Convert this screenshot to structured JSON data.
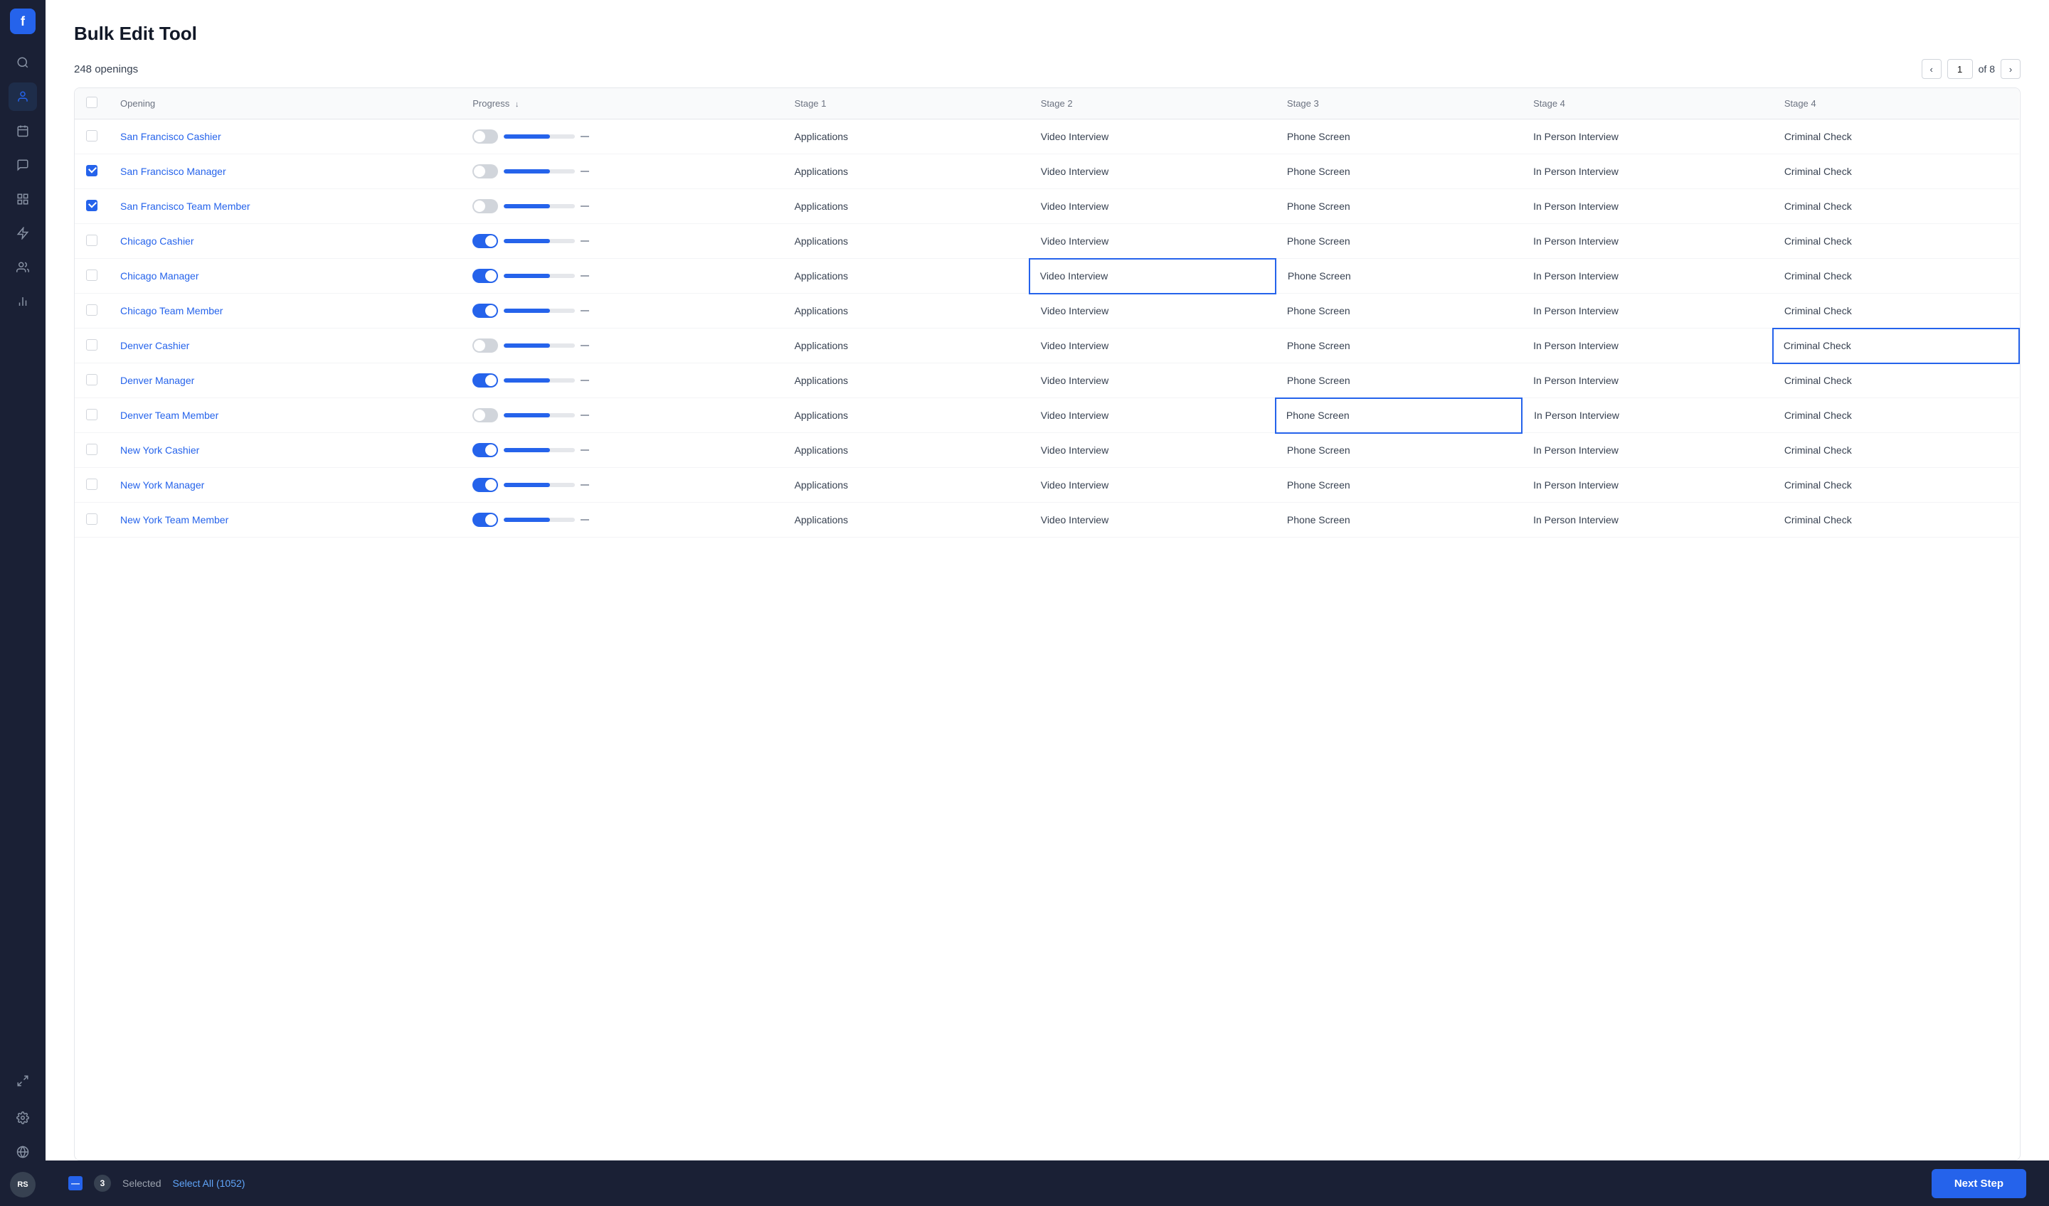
{
  "app": {
    "logo": "f",
    "avatar": "RS"
  },
  "sidebar": {
    "icons": [
      {
        "name": "search-icon",
        "symbol": "🔍"
      },
      {
        "name": "person-icon",
        "symbol": "👤"
      },
      {
        "name": "calendar-icon",
        "symbol": "📅"
      },
      {
        "name": "chat-icon",
        "symbol": "💬"
      },
      {
        "name": "list-icon",
        "symbol": "📋"
      },
      {
        "name": "bolt-icon",
        "symbol": "⚡"
      },
      {
        "name": "users-icon",
        "symbol": "👥"
      },
      {
        "name": "chart-icon",
        "symbol": "📊"
      }
    ]
  },
  "page": {
    "title": "Bulk Edit Tool",
    "openings_count": "248 openings",
    "current_page": "1",
    "total_pages": "of 8"
  },
  "table": {
    "columns": [
      "Opening",
      "Progress ↓",
      "Stage 1",
      "Stage 2",
      "Stage 3",
      "Stage 4",
      "Stage 4"
    ],
    "rows": [
      {
        "id": 1,
        "name": "San Francisco Cashier",
        "checked": false,
        "toggle": "off",
        "progress": 65,
        "stage1": "Applications",
        "stage2": "Video Interview",
        "stage3": "Phone Screen",
        "stage4a": "In Person Interview",
        "stage4b": "Criminal Check",
        "stage2_highlight": false,
        "stage3_highlight": false,
        "stage4b_highlight": false
      },
      {
        "id": 2,
        "name": "San Francisco Manager",
        "checked": true,
        "toggle": "off",
        "progress": 65,
        "stage1": "Applications",
        "stage2": "Video Interview",
        "stage3": "Phone Screen",
        "stage4a": "In Person Interview",
        "stage4b": "Criminal Check",
        "stage2_highlight": false,
        "stage3_highlight": false,
        "stage4b_highlight": false
      },
      {
        "id": 3,
        "name": "San Francisco Team Member",
        "checked": true,
        "toggle": "off",
        "progress": 65,
        "stage1": "Applications",
        "stage2": "Video Interview",
        "stage3": "Phone Screen",
        "stage4a": "In Person Interview",
        "stage4b": "Criminal Check",
        "stage2_highlight": false,
        "stage3_highlight": false,
        "stage4b_highlight": false
      },
      {
        "id": 4,
        "name": "Chicago Cashier",
        "checked": false,
        "toggle": "on",
        "progress": 65,
        "stage1": "Applications",
        "stage2": "Video Interview",
        "stage3": "Phone Screen",
        "stage4a": "In Person Interview",
        "stage4b": "Criminal Check",
        "stage2_highlight": false,
        "stage3_highlight": false,
        "stage4b_highlight": false
      },
      {
        "id": 5,
        "name": "Chicago Manager",
        "checked": false,
        "toggle": "on",
        "progress": 65,
        "stage1": "Applications",
        "stage2": "Video Interview",
        "stage3": "Phone Screen",
        "stage4a": "In Person Interview",
        "stage4b": "Criminal Check",
        "stage2_highlight": true,
        "stage3_highlight": false,
        "stage4b_highlight": false
      },
      {
        "id": 6,
        "name": "Chicago Team Member",
        "checked": false,
        "toggle": "on",
        "progress": 65,
        "stage1": "Applications",
        "stage2": "Video Interview",
        "stage3": "Phone Screen",
        "stage4a": "In Person Interview",
        "stage4b": "Criminal Check",
        "stage2_highlight": false,
        "stage3_highlight": false,
        "stage4b_highlight": false
      },
      {
        "id": 7,
        "name": "Denver Cashier",
        "checked": false,
        "toggle": "off",
        "progress": 65,
        "stage1": "Applications",
        "stage2": "Video Interview",
        "stage3": "Phone Screen",
        "stage4a": "In Person Interview",
        "stage4b": "Criminal Check",
        "stage2_highlight": false,
        "stage3_highlight": false,
        "stage4b_highlight": true
      },
      {
        "id": 8,
        "name": "Denver Manager",
        "checked": false,
        "toggle": "on",
        "progress": 65,
        "stage1": "Applications",
        "stage2": "Video Interview",
        "stage3": "Phone Screen",
        "stage4a": "In Person Interview",
        "stage4b": "Criminal Check",
        "stage2_highlight": false,
        "stage3_highlight": false,
        "stage4b_highlight": false
      },
      {
        "id": 9,
        "name": "Denver Team Member",
        "checked": false,
        "toggle": "off",
        "progress": 65,
        "stage1": "Applications",
        "stage2": "Video Interview",
        "stage3": "Phone Screen",
        "stage4a": "In Person Interview",
        "stage4b": "Criminal Check",
        "stage2_highlight": false,
        "stage3_highlight": true,
        "stage4b_highlight": false
      },
      {
        "id": 10,
        "name": "New York Cashier",
        "checked": false,
        "toggle": "on",
        "progress": 65,
        "stage1": "Applications",
        "stage2": "Video Interview",
        "stage3": "Phone Screen",
        "stage4a": "In Person Interview",
        "stage4b": "Criminal Check",
        "stage2_highlight": false,
        "stage3_highlight": false,
        "stage4b_highlight": false
      },
      {
        "id": 11,
        "name": "New York Manager",
        "checked": false,
        "toggle": "on",
        "progress": 65,
        "stage1": "Applications",
        "stage2": "Video Interview",
        "stage3": "Phone Screen",
        "stage4a": "In Person Interview",
        "stage4b": "Criminal Check",
        "stage2_highlight": false,
        "stage3_highlight": false,
        "stage4b_highlight": false
      },
      {
        "id": 12,
        "name": "New York Team Member",
        "checked": false,
        "toggle": "on",
        "progress": 65,
        "stage1": "Applications",
        "stage2": "Video Interview",
        "stage3": "Phone Screen",
        "stage4a": "In Person Interview",
        "stage4b": "Criminal Check",
        "stage2_highlight": false,
        "stage3_highlight": false,
        "stage4b_highlight": false
      }
    ]
  },
  "bottom_bar": {
    "selected_count": "3",
    "selected_label": "Selected",
    "select_all_label": "Select All (1052)",
    "next_step_label": "Next Step"
  }
}
